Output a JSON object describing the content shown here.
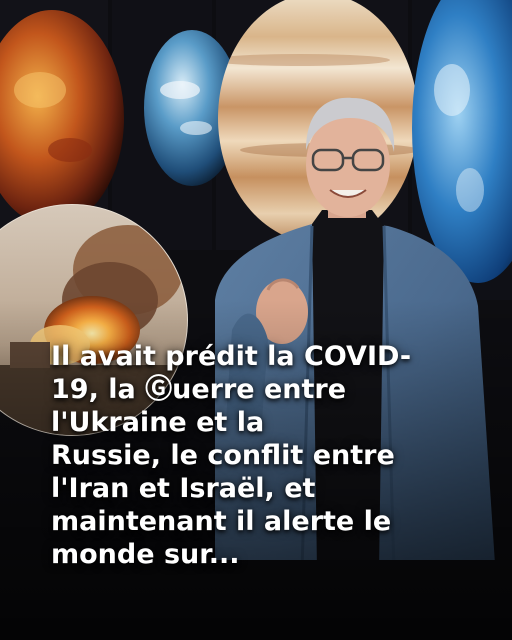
{
  "caption": {
    "lines": [
      "Il avait prédit la COVID-",
      "19, la Ⓖuerre entre",
      "l'Ukraine et la",
      "Russie, le conflit entre",
      "l'Iran et Israël, et",
      "maintenant il alerte le",
      "monde sur..."
    ]
  },
  "colors": {
    "background": "#0b0b0e",
    "caption_text": "#ffffff",
    "jacket": "#4b6a8e",
    "turtleneck": "#111114",
    "hair": "#c8c8cc"
  }
}
